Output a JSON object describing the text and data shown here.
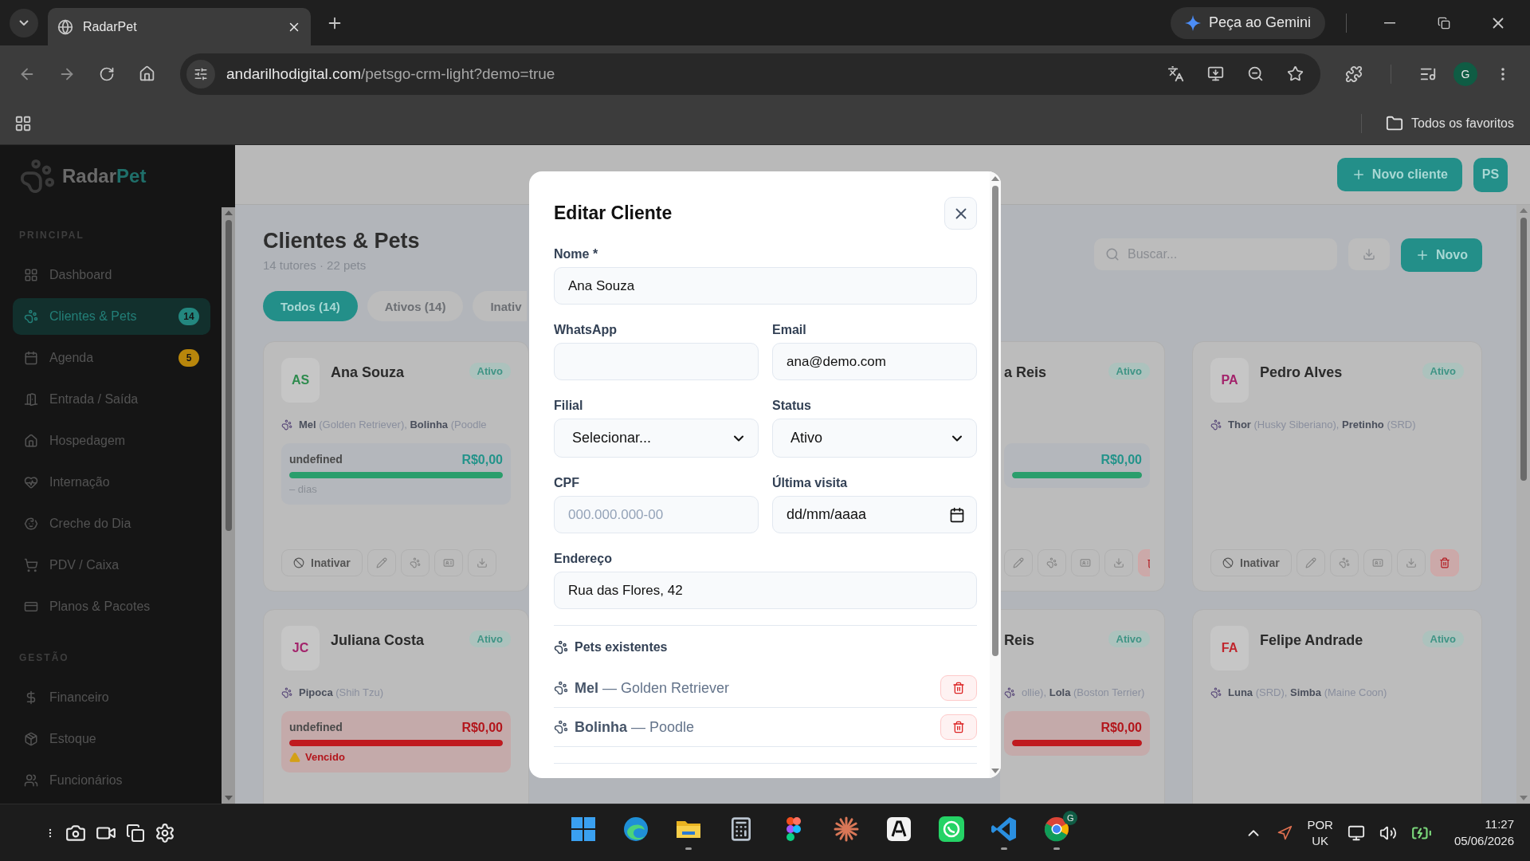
{
  "browser": {
    "tab_title": "RadarPet",
    "gemini": "Peça ao Gemini",
    "url_host": "andarilhodigital.com",
    "url_path": "/petsgo-crm-light?demo=true",
    "profile": "G",
    "bookmarks_folder": "Todos os favoritos"
  },
  "sidebar": {
    "brand_main": "Radar",
    "brand_accent": "Pet",
    "sections": [
      {
        "title": "PRINCIPAL",
        "items": [
          {
            "label": "Dashboard",
            "selected": false
          },
          {
            "label": "Clientes & Pets",
            "selected": true,
            "badge": "14",
            "color": "#23877f"
          },
          {
            "label": "Agenda",
            "selected": false,
            "badge": "5",
            "color": "#b8860b"
          },
          {
            "label": "Entrada / Saída",
            "selected": false
          },
          {
            "label": "Hospedagem",
            "selected": false
          },
          {
            "label": "Internação",
            "selected": false
          },
          {
            "label": "Creche do Dia",
            "selected": false
          },
          {
            "label": "PDV / Caixa",
            "selected": false
          },
          {
            "label": "Planos & Pacotes",
            "selected": false
          }
        ]
      },
      {
        "title": "GESTÃO",
        "items": [
          {
            "label": "Financeiro",
            "selected": false
          },
          {
            "label": "Estoque",
            "selected": false
          },
          {
            "label": "Funcionários",
            "selected": false
          }
        ]
      }
    ]
  },
  "topbar": {
    "new_client": "Novo cliente",
    "user_initials": "PS"
  },
  "content": {
    "title": "Clientes & Pets",
    "subtitle": "14 tutores · 22 pets",
    "filters": [
      {
        "label": "Todos (14)",
        "selected": true
      },
      {
        "label": "Ativos (14)",
        "selected": false
      },
      {
        "label": "Inativ",
        "selected": false
      }
    ],
    "search_placeholder": "Buscar...",
    "new_button": "Novo"
  },
  "card_columns": [
    [
      {
        "initials": "AS",
        "color": "#2e8b4e",
        "name": "Ana Souza",
        "status": "Ativo",
        "pets": "**Mel** (Golden Retriever), **Bolinha** (Poodle",
        "plan": {
          "kind": "ok",
          "label": "undefined",
          "amount": "R$0,00",
          "level": 1,
          "note": "– dias"
        },
        "toggle": "Inativar"
      },
      {
        "initials": "JC",
        "color": "#a3236b",
        "name": "Juliana Costa",
        "status": "Ativo",
        "pets": "**Pipoca** (Shih Tzu)",
        "plan": {
          "kind": "overdue",
          "label": "undefined",
          "amount": "R$0,00",
          "level": 1,
          "note": "Vencido"
        }
      }
    ],
    [
      {
        "name": "a Reis",
        "status": "Ativo",
        "plan": {
          "kind": "ok",
          "amount": "R$0,00",
          "level": 1
        }
      },
      {
        "name": "Reis",
        "status": "Ativo",
        "pets": "ollie), **Lola** (Boston Terrier)",
        "plan": {
          "kind": "overdue",
          "amount": "R$0,00",
          "level": 1
        }
      }
    ],
    [
      {
        "initials": "PA",
        "color": "#a3236b",
        "name": "Pedro Alves",
        "status": "Ativo",
        "pets": "**Thor** (Husky Siberiano), **Pretinho** (SRD)",
        "toggle": "Inativar"
      },
      {
        "initials": "FA",
        "color": "#c0262d",
        "name": "Felipe Andrade",
        "status": "Ativo",
        "pets": "**Luna** (SRD), **Simba** (Maine Coon)"
      }
    ]
  ],
  "modal": {
    "title": "Editar Cliente",
    "fields": [
      {
        "label": "Nome *",
        "kind": "text",
        "value": "Ana Souza",
        "wide": true
      },
      {
        "label": "WhatsApp",
        "kind": "text",
        "wide": false
      },
      {
        "label": "Email",
        "kind": "text",
        "value": "ana@demo.com",
        "wide": false
      },
      {
        "label": "Filial",
        "kind": "select",
        "value": "Selecionar...",
        "wide": false
      },
      {
        "label": "Status",
        "kind": "select",
        "value": "Ativo",
        "wide": false
      },
      {
        "label": "CPF",
        "kind": "text",
        "placeholder": "000.000.000-00",
        "wide": false
      },
      {
        "label": "Última visita",
        "kind": "date",
        "value": "dd/mm/aaaa",
        "wide": false
      },
      {
        "label": "Endereço",
        "kind": "text",
        "value": "Rua das Flores, 42",
        "wide": true
      }
    ],
    "pets_title": "Pets existentes",
    "pets": [
      "**Mel** — Golden Retriever",
      "**Bolinha** — Poodle"
    ]
  },
  "taskbar": {
    "apps": [
      {
        "running": false
      },
      {
        "running": false
      },
      {
        "running": true
      },
      {
        "running": false
      },
      {
        "running": false
      },
      {
        "running": false
      },
      {
        "running": false
      },
      {
        "running": false
      },
      {
        "running": true
      },
      {
        "running": true
      }
    ],
    "chrome_badge": "G",
    "lang_1": "POR",
    "lang_2": "UK",
    "time": "11:27",
    "date": "05/06/2026"
  }
}
